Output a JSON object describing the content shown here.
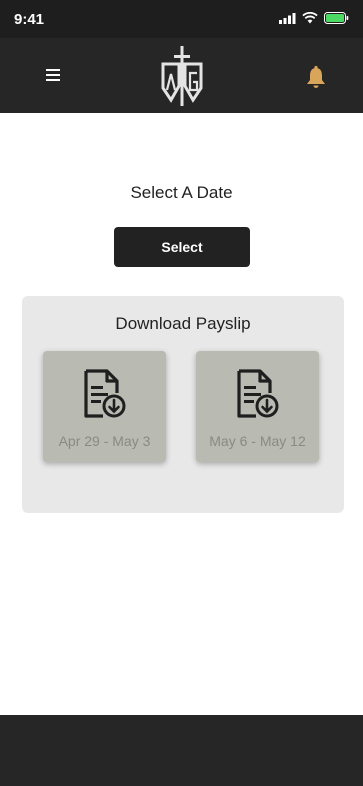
{
  "status_bar": {
    "time": "9:41"
  },
  "header": {
    "menu_icon": "hamburger-menu-icon",
    "logo_icon": "ag-sword-logo",
    "notification_icon": "bell-icon",
    "accent_color": "#d9a55a"
  },
  "date_section": {
    "title": "Select A Date",
    "select_button_label": "Select"
  },
  "payslip_section": {
    "title": "Download Payslip",
    "items": [
      {
        "label": "Apr 29 - May 3",
        "icon": "document-download-icon"
      },
      {
        "label": "May 6 - May 12",
        "icon": "document-download-icon"
      }
    ]
  }
}
